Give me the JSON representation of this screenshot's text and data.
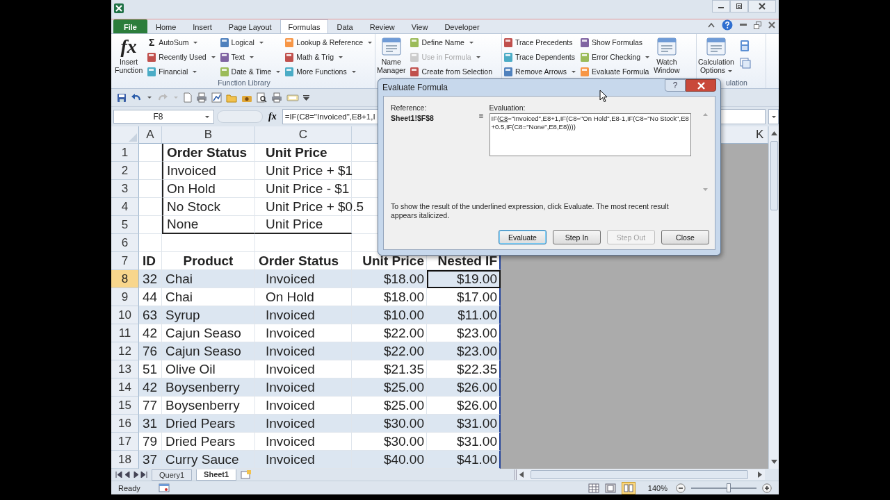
{
  "ribbon_tabs": [
    {
      "label": "File",
      "kind": "backstage",
      "selected": false
    },
    {
      "label": "Home",
      "kind": "tab",
      "selected": false
    },
    {
      "label": "Insert",
      "kind": "tab",
      "selected": false
    },
    {
      "label": "Page Layout",
      "kind": "tab",
      "selected": false
    },
    {
      "label": "Formulas",
      "kind": "tab",
      "selected": true
    },
    {
      "label": "Data",
      "kind": "tab",
      "selected": false
    },
    {
      "label": "Review",
      "kind": "tab",
      "selected": false
    },
    {
      "label": "View",
      "kind": "tab",
      "selected": false
    },
    {
      "label": "Developer",
      "kind": "tab",
      "selected": false
    }
  ],
  "ribbon": {
    "groups": [
      {
        "label": "Function Library",
        "columns": [
          {
            "kind": "large",
            "glyph": "fx",
            "label_lines": [
              "Insert",
              "Function"
            ],
            "dropdown": false
          },
          {
            "kind": "small",
            "items": [
              {
                "glyph": "Σ",
                "label": "AutoSum",
                "dropdown": true,
                "disabled": false
              },
              {
                "label": "Recently Used",
                "dropdown": true,
                "disabled": false
              },
              {
                "label": "Financial",
                "dropdown": true,
                "disabled": false
              }
            ]
          },
          {
            "kind": "small",
            "items": [
              {
                "label": "Logical",
                "dropdown": true,
                "disabled": false
              },
              {
                "label": "Text",
                "dropdown": true,
                "disabled": false
              },
              {
                "label": "Date & Time",
                "dropdown": true,
                "disabled": false
              }
            ]
          },
          {
            "kind": "small",
            "items": [
              {
                "label": "Lookup & Reference",
                "dropdown": true,
                "disabled": false
              },
              {
                "label": "Math & Trig",
                "dropdown": true,
                "disabled": false
              },
              {
                "label": "More Functions",
                "dropdown": true,
                "disabled": false
              }
            ]
          }
        ]
      },
      {
        "columns": [
          {
            "kind": "large",
            "label_lines": [
              "Name",
              "Manager"
            ],
            "dropdown": false
          },
          {
            "kind": "small",
            "items": [
              {
                "label": "Define Name",
                "dropdown": true,
                "disabled": false
              },
              {
                "label": "Use in Formula",
                "dropdown": true,
                "disabled": true
              },
              {
                "label": "Create from Selection",
                "dropdown": false,
                "disabled": false
              }
            ]
          }
        ]
      },
      {
        "columns": [
          {
            "kind": "small",
            "items": [
              {
                "label": "Trace Precedents",
                "dropdown": false,
                "disabled": false
              },
              {
                "label": "Trace Dependents",
                "dropdown": false,
                "disabled": false
              },
              {
                "label": "Remove Arrows",
                "dropdown": true,
                "disabled": false
              }
            ]
          },
          {
            "kind": "small",
            "items": [
              {
                "label": "Show Formulas",
                "dropdown": false,
                "disabled": false
              },
              {
                "label": "Error Checking",
                "dropdown": true,
                "disabled": false
              },
              {
                "label": "Evaluate Formula",
                "dropdown": false,
                "disabled": false
              }
            ]
          },
          {
            "kind": "large",
            "label_lines": [
              "Watch",
              "Window"
            ],
            "dropdown": false
          }
        ]
      },
      {
        "label": "ulation",
        "columns": [
          {
            "kind": "large",
            "label_lines": [
              "Calculation",
              "Options"
            ],
            "dropdown": true
          },
          {
            "kind": "icon_stack"
          }
        ]
      }
    ]
  },
  "formula_bar": {
    "name_box": "F8",
    "fx": "fx",
    "formula": "=IF(C8=\"Invoiced\",E8+1,I"
  },
  "sheet": {
    "columns": [
      {
        "label": "A",
        "selected": false
      },
      {
        "label": "B",
        "selected": false
      },
      {
        "label": "C",
        "selected": false
      }
    ],
    "far_column": "K",
    "row_headers": [
      {
        "label": "1",
        "selected": false
      },
      {
        "label": "2",
        "selected": false
      },
      {
        "label": "3",
        "selected": false
      },
      {
        "label": "4",
        "selected": false
      },
      {
        "label": "5",
        "selected": false
      },
      {
        "label": "6",
        "selected": false
      },
      {
        "label": "7",
        "selected": false
      },
      {
        "label": "8",
        "selected": true
      },
      {
        "label": "9",
        "selected": false
      },
      {
        "label": "10",
        "selected": false
      },
      {
        "label": "11",
        "selected": false
      },
      {
        "label": "12",
        "selected": false
      },
      {
        "label": "13",
        "selected": false
      },
      {
        "label": "14",
        "selected": false
      },
      {
        "label": "15",
        "selected": false
      },
      {
        "label": "16",
        "selected": false
      },
      {
        "label": "17",
        "selected": false
      },
      {
        "label": "18",
        "selected": false
      }
    ],
    "lookup_table": {
      "columns": [
        "Order Status",
        "Unit Price"
      ],
      "rows": [
        [
          "Invoiced",
          "Unit Price + $1"
        ],
        [
          "On Hold",
          "Unit Price - $1"
        ],
        [
          "No Stock",
          "Unit Price + $0.5"
        ],
        [
          "None",
          "Unit Price"
        ]
      ]
    },
    "orders_table": {
      "columns": [
        "ID",
        "Product",
        "Order Status",
        "Unit Price",
        "Nested IF"
      ],
      "rows": [
        {
          "id": "32",
          "product": "Chai",
          "status": "Invoiced",
          "unit_price": "$18.00",
          "nested_if": "$19.00",
          "active": true
        },
        {
          "id": "44",
          "product": "Chai",
          "status": "On Hold",
          "unit_price": "$18.00",
          "nested_if": "$17.00",
          "active": false
        },
        {
          "id": "63",
          "product": "Syrup",
          "status": "Invoiced",
          "unit_price": "$10.00",
          "nested_if": "$11.00",
          "active": false
        },
        {
          "id": "42",
          "product": "Cajun Seaso",
          "status": "Invoiced",
          "unit_price": "$22.00",
          "nested_if": "$23.00",
          "active": false
        },
        {
          "id": "76",
          "product": "Cajun Seaso",
          "status": "Invoiced",
          "unit_price": "$22.00",
          "nested_if": "$23.00",
          "active": false
        },
        {
          "id": "51",
          "product": "Olive Oil",
          "status": "Invoiced",
          "unit_price": "$21.35",
          "nested_if": "$22.35",
          "active": false
        },
        {
          "id": "42",
          "product": "Boysenberry",
          "status": "Invoiced",
          "unit_price": "$25.00",
          "nested_if": "$26.00",
          "active": false
        },
        {
          "id": "77",
          "product": "Boysenberry",
          "status": "Invoiced",
          "unit_price": "$25.00",
          "nested_if": "$26.00",
          "active": false
        },
        {
          "id": "31",
          "product": "Dried Pears",
          "status": "Invoiced",
          "unit_price": "$30.00",
          "nested_if": "$31.00",
          "active": false
        },
        {
          "id": "79",
          "product": "Dried Pears",
          "status": "Invoiced",
          "unit_price": "$30.00",
          "nested_if": "$31.00",
          "active": false
        },
        {
          "id": "37",
          "product": "Curry Sauce",
          "status": "Invoiced",
          "unit_price": "$40.00",
          "nested_if": "$41.00",
          "active": false
        }
      ]
    }
  },
  "sheet_tabs": [
    {
      "label": "Query1",
      "selected": false
    },
    {
      "label": "Sheet1",
      "selected": true
    }
  ],
  "status_bar": {
    "status": "Ready",
    "zoom": "140%",
    "level": 0.57
  },
  "dialog": {
    "title": "Evaluate Formula",
    "help": "?",
    "reference_label": "Reference:",
    "reference": "Sheet1!$F$8",
    "equals": "=",
    "evaluation_label": "Evaluation:",
    "evaluation": [
      {
        "text": "IF(",
        "underlined": false
      },
      {
        "text": "C8",
        "underlined": true
      },
      {
        "text": "=\"Invoiced\",E8+1,IF(C8=\"On Hold\",E8-1,IF(C8=\"No Stock\",E8+0.5,IF(C8=\"None\",E8,E8))))",
        "underlined": false
      }
    ],
    "note": "To show the result of the underlined expression, click Evaluate.  The most recent result appears italicized.",
    "buttons": [
      {
        "label": "Evaluate",
        "default": true,
        "disabled": false
      },
      {
        "label": "Step In",
        "default": false,
        "disabled": false
      },
      {
        "label": "Step Out",
        "default": false,
        "disabled": true
      },
      {
        "label": "Close",
        "default": false,
        "disabled": false
      }
    ]
  }
}
